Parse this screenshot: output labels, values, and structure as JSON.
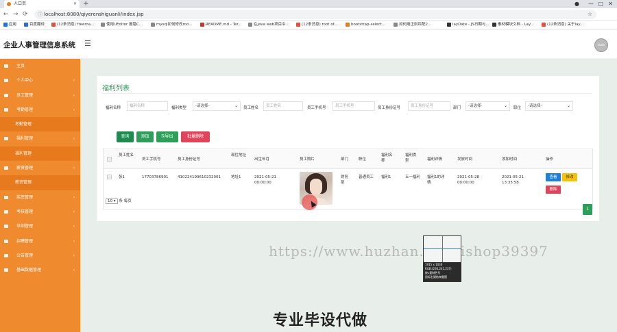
{
  "browser": {
    "tab_title": "人口页",
    "url": "localhost:8080/qiyerenshiguanli/index.jsp",
    "bookmarks": [
      {
        "label": "应用",
        "color": "#1a73e8"
      },
      {
        "label": "百度翻译",
        "color": "#2e6bd8"
      },
      {
        "label": "(12条消息) freema...",
        "color": "#e74c3c"
      },
      {
        "label": "使用UEditor 报错C...",
        "color": "#888888"
      },
      {
        "label": "mysql如何修改roo...",
        "color": "#888888"
      },
      {
        "label": "README.md - Ter...",
        "color": "#c0392b"
      },
      {
        "label": "在java web项目中...",
        "color": "#888888"
      },
      {
        "label": "(12条消息) root of...",
        "color": "#e74c3c"
      },
      {
        "label": "bootstrap-select...",
        "color": "#e67e22"
      },
      {
        "label": "如何用正则匹配2...",
        "color": "#888888"
      },
      {
        "label": "layDate - JS日期与...",
        "color": "#333333"
      },
      {
        "label": "素材模块文档 - Lay...",
        "color": "#333333"
      },
      {
        "label": "(12条消息) 关于lay...",
        "color": "#e74c3c"
      }
    ]
  },
  "header": {
    "title": "企业人事管理信息系统",
    "menu_icon": "hamburger-icon",
    "avatar_text": "dude"
  },
  "sidebar": {
    "items": [
      {
        "label": "主页",
        "type": "item",
        "arrow": ""
      },
      {
        "label": "个人中心",
        "type": "item",
        "arrow": "‹"
      },
      {
        "label": "员工管理",
        "type": "item",
        "arrow": "‹"
      },
      {
        "label": "考勤管理",
        "type": "item",
        "arrow": "‹"
      },
      {
        "label": "考勤管理",
        "type": "sub",
        "arrow": ""
      },
      {
        "label": "福利管理",
        "type": "item",
        "arrow": "‹"
      },
      {
        "label": "福利管理",
        "type": "sub",
        "arrow": ""
      },
      {
        "label": "薪资管理",
        "type": "item",
        "arrow": "‹"
      },
      {
        "label": "薪资管理",
        "type": "sub",
        "arrow": ""
      },
      {
        "label": "奖惩管理",
        "type": "item",
        "arrow": "‹"
      },
      {
        "label": "考核管理",
        "type": "item",
        "arrow": "‹"
      },
      {
        "label": "培训管理",
        "type": "item",
        "arrow": "‹"
      },
      {
        "label": "招聘管理",
        "type": "item",
        "arrow": "‹"
      },
      {
        "label": "公告管理",
        "type": "item",
        "arrow": "‹"
      },
      {
        "label": "基础数据管理",
        "type": "item",
        "arrow": "‹"
      }
    ]
  },
  "page": {
    "title": "福利列表",
    "filters": {
      "welfare_name_label": "福利名称",
      "welfare_name_placeholder": "福利名称",
      "welfare_type_label": "福利类型",
      "welfare_type_value": "-请选择-",
      "emp_name_label": "员工姓名",
      "emp_name_placeholder": "员工姓名",
      "emp_phone_label": "员工手机号",
      "emp_phone_placeholder": "员工手机号",
      "emp_id_label": "员工身份证号",
      "emp_id_placeholder": "员工身份证号",
      "dept_label": "部门",
      "dept_value": "-请选择-",
      "position_label": "职位",
      "position_value": "-请选择-"
    },
    "buttons": {
      "query": "查询",
      "add": "添加",
      "export": "导出",
      "batch_delete": "批量删除"
    },
    "table": {
      "headers": [
        "员工姓名",
        "员工手机号",
        "员工身份证号",
        "现住地址",
        "出生年月",
        "员工照片",
        "部门",
        "职位",
        "福利名称",
        "福利类型",
        "福利详情",
        "发放时间",
        "添加时间",
        "操作"
      ],
      "rows": [
        {
          "name": "张1",
          "phone": "17703786901",
          "id_card": "410224199610232001",
          "address": "地址1",
          "birth": "2021-05-21 00:00:00",
          "dept": "财务部",
          "position": "普通员工",
          "welfare_name": "福利1",
          "welfare_type": "五一福利",
          "welfare_detail": "福利1的详情",
          "issue_time": "2021-05-28 00:00:00",
          "add_time": "2021-05-21 13:35:58",
          "ops": {
            "view": "查看",
            "edit": "修改",
            "delete": "删除"
          }
        }
      ]
    },
    "pager": {
      "page_size": "10",
      "page_size_suffix": "条 每页",
      "current_page": "1"
    }
  },
  "overlay": {
    "watermark": "https://www.huzhan.com/ishop39397",
    "color_picker": {
      "size": "1915 x 1036",
      "rgb": "RGB:(230,241,237)",
      "line3": "按c复制色号",
      "line4": "鼠标右键结束截图"
    },
    "banner": "专业毕设代做"
  }
}
